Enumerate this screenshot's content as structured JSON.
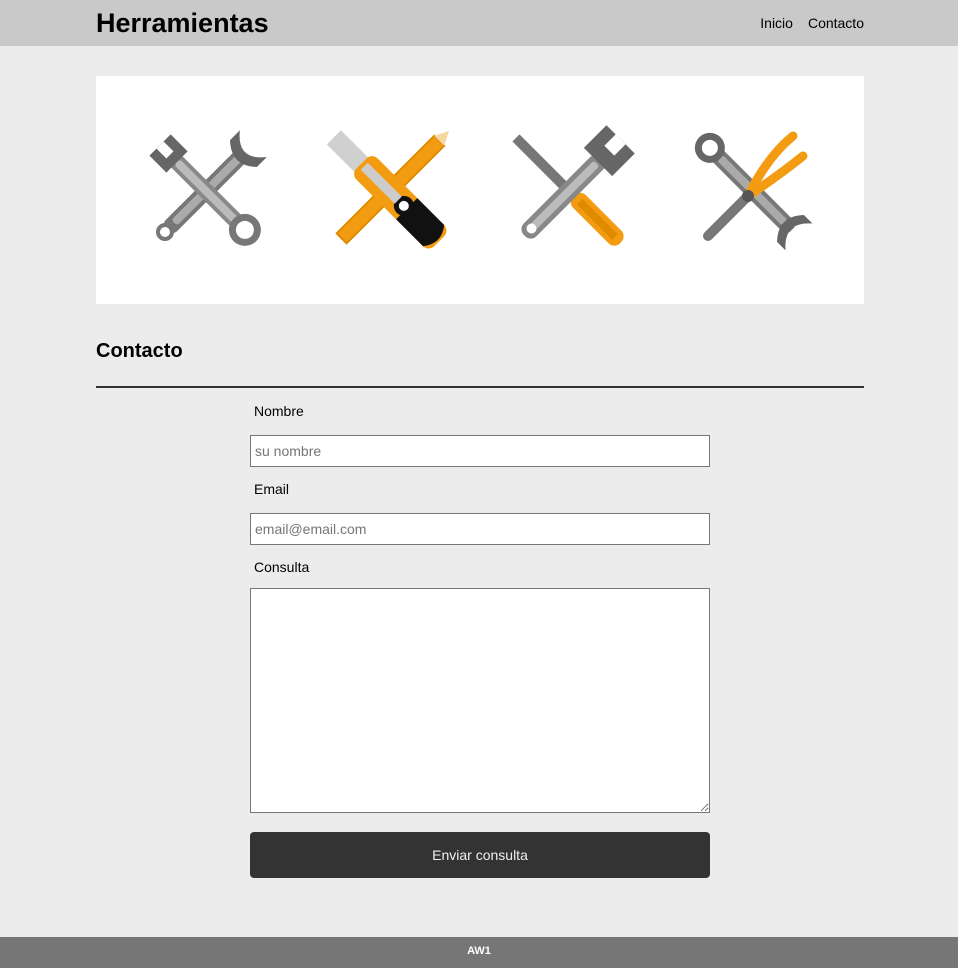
{
  "header": {
    "brand": "Herramientas",
    "nav": [
      {
        "label": "Inicio"
      },
      {
        "label": "Contacto"
      }
    ]
  },
  "banner": {
    "icons": [
      "wrench-and-adjustable-wrench-icon",
      "utility-knife-and-pencil-icon",
      "adjustable-wrench-and-screwdriver-icon",
      "wrench-and-pliers-icon"
    ],
    "colors": {
      "orange": "#f39c12",
      "gray": "#666666",
      "light_gray": "#999999"
    }
  },
  "contact": {
    "title": "Contacto",
    "name_label": "Nombre",
    "name_placeholder": "su nombre",
    "email_label": "Email",
    "email_placeholder": "email@email.com",
    "message_label": "Consulta",
    "submit_label": "Enviar consulta"
  },
  "footer": {
    "text": "AW1"
  }
}
